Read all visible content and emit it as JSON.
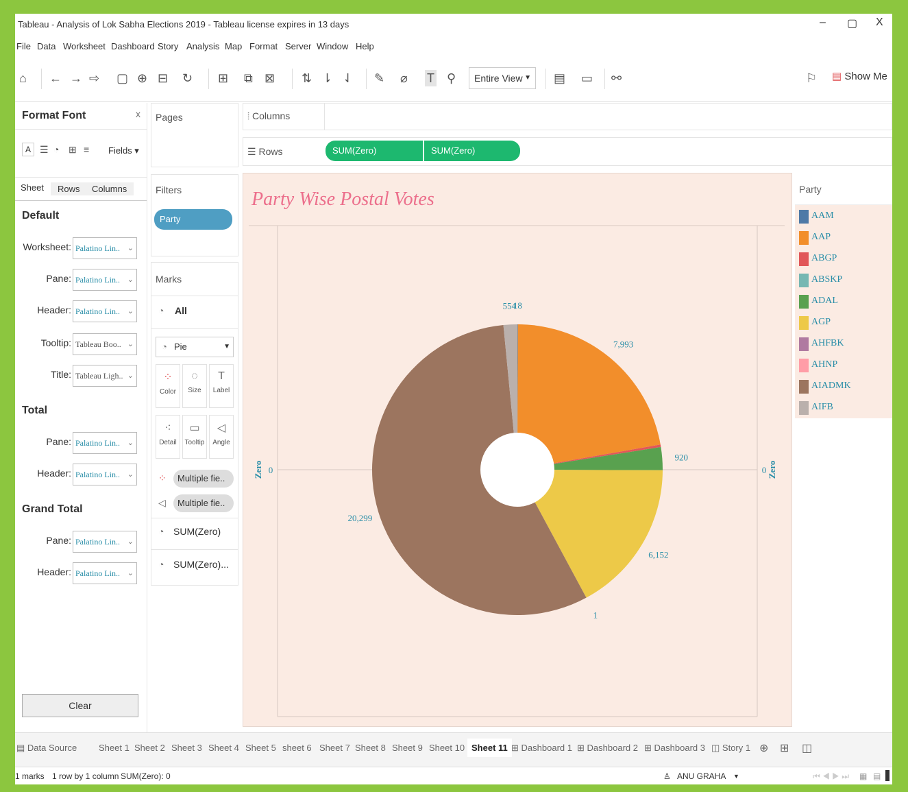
{
  "titlebar": {
    "title": "Tableau - Analysis of  Lok Sabha Elections 2019 - Tableau license expires in 13 days",
    "min": "–",
    "max": "▢",
    "close": "X"
  },
  "menu": [
    "File",
    "Data",
    "Worksheet",
    "Dashboard",
    "Story",
    "Analysis",
    "Map",
    "Format",
    "Server",
    "Window",
    "Help"
  ],
  "toolbar": {
    "view_mode": "Entire View",
    "show_me": "Show Me"
  },
  "format_panel": {
    "title": "Format Font",
    "close": "x",
    "fields_label": "Fields",
    "tabs": [
      "Sheet",
      "Rows",
      "Columns"
    ],
    "default_label": "Default",
    "default_rows": [
      {
        "label": "Worksheet:",
        "value": "Palatino Lin.."
      },
      {
        "label": "Pane:",
        "value": "Palatino Lin.."
      },
      {
        "label": "Header:",
        "value": "Palatino Lin.."
      },
      {
        "label": "Tooltip:",
        "value": "Tableau Boo.."
      },
      {
        "label": "Title:",
        "value": "Tableau Ligh.."
      }
    ],
    "total_label": "Total",
    "total_rows": [
      {
        "label": "Pane:",
        "value": "Palatino Lin.."
      },
      {
        "label": "Header:",
        "value": "Palatino Lin.."
      }
    ],
    "grand_total_label": "Grand Total",
    "grand_total_rows": [
      {
        "label": "Pane:",
        "value": "Palatino Lin.."
      },
      {
        "label": "Header:",
        "value": "Palatino Lin.."
      }
    ],
    "clear_button": "Clear"
  },
  "pages_label": "Pages",
  "filters": {
    "label": "Filters",
    "pill": "Party"
  },
  "marks": {
    "label": "Marks",
    "all_label": "All",
    "type": "Pie",
    "buttons": [
      "Color",
      "Size",
      "Label",
      "Detail",
      "Tooltip",
      "Angle"
    ],
    "fields": [
      "Multiple fie..",
      "Multiple fie.."
    ],
    "measures": [
      "SUM(Zero)",
      "SUM(Zero)..."
    ]
  },
  "shelves": {
    "columns_label": "Columns",
    "rows_label": "Rows",
    "row_pills": [
      "SUM(Zero)",
      "SUM(Zero)"
    ]
  },
  "legend": {
    "title": "Party",
    "items": [
      {
        "name": "AAM",
        "color": "#4e79a7"
      },
      {
        "name": "AAP",
        "color": "#f28e2b"
      },
      {
        "name": "ABGP",
        "color": "#e15759"
      },
      {
        "name": "ABSKP",
        "color": "#76b7b2"
      },
      {
        "name": "ADAL",
        "color": "#59a14f"
      },
      {
        "name": "AGP",
        "color": "#edc948"
      },
      {
        "name": "AHFBK",
        "color": "#b07aa1"
      },
      {
        "name": "AHNP",
        "color": "#ff9da7"
      },
      {
        "name": "AIADMK",
        "color": "#9c755f"
      },
      {
        "name": "AIFB",
        "color": "#bab0ac"
      }
    ]
  },
  "chart_data": {
    "type": "pie",
    "title": "Party Wise Postal Votes",
    "axis_label_left": "Zero",
    "axis_label_right": "Zero",
    "axis_tick_left": "0",
    "axis_tick_right": "0",
    "slices": [
      {
        "label": "18",
        "value": 18,
        "color": "#4e79a7"
      },
      {
        "label": "7,993",
        "value": 7993,
        "color": "#f28e2b"
      },
      {
        "label": "",
        "value": 100,
        "color": "#e15759"
      },
      {
        "label": "920",
        "value": 920,
        "color": "#59a14f"
      },
      {
        "label": "6,152",
        "value": 6152,
        "color": "#edc948"
      },
      {
        "label": "1",
        "value": 1,
        "color": "#b07aa1"
      },
      {
        "label": "20,299",
        "value": 20299,
        "color": "#9c755f"
      },
      {
        "label": "554",
        "value": 554,
        "color": "#bab0ac"
      }
    ]
  },
  "sheet_tabs": [
    "Data Source",
    "Sheet 1",
    "Sheet 2",
    "Sheet 3",
    "Sheet 4",
    "Sheet 5",
    "sheet 6",
    "Sheet 7",
    "Sheet 8",
    "Sheet 9",
    "Sheet 10",
    "Sheet 11",
    "Dashboard 1",
    "Dashboard 2",
    "Dashboard 3",
    "Story 1"
  ],
  "active_tab": "Sheet 11",
  "status": {
    "marks": "1 marks",
    "rows": "1 row by 1 column",
    "sum": "SUM(Zero): 0",
    "user": "ANU GRAHA"
  }
}
